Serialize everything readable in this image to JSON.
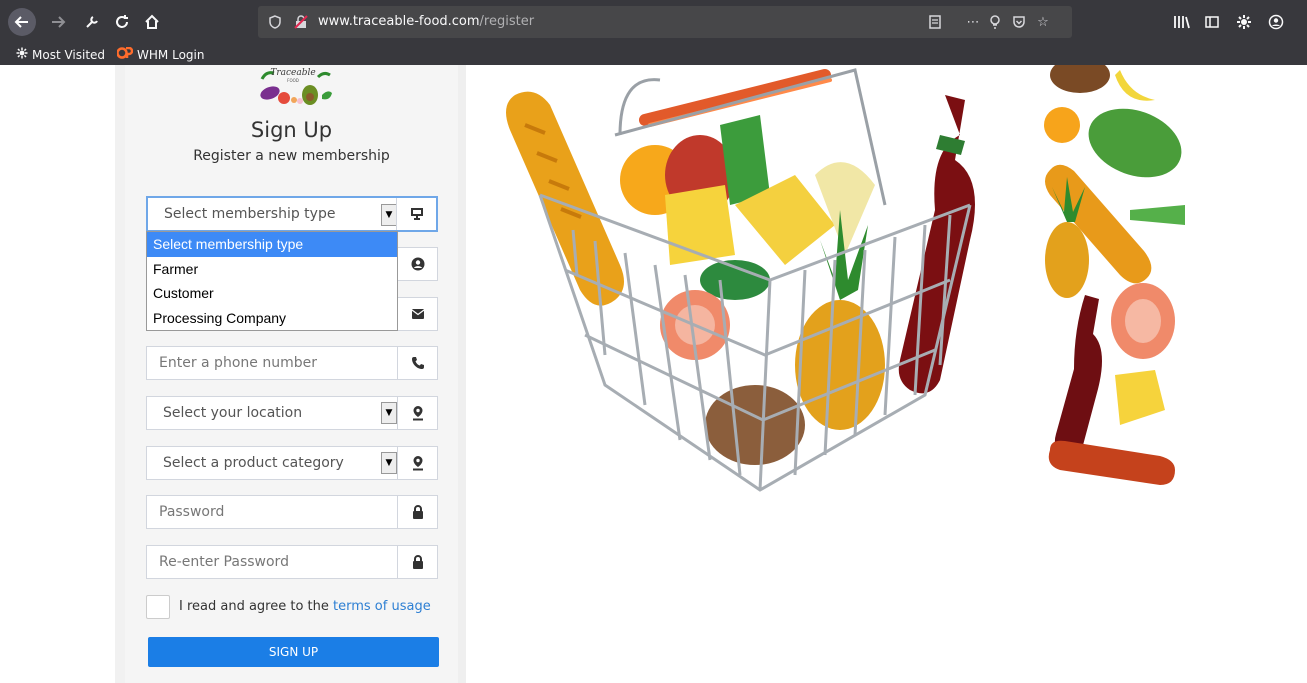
{
  "browser": {
    "url_host": "www.traceable-food.com",
    "url_path": "/register",
    "bookmarks": [
      {
        "label": "Most Visited"
      },
      {
        "label": "WHM Login"
      }
    ]
  },
  "logo": {
    "text": "Traceable",
    "subtext": "FOOD"
  },
  "form": {
    "title": "Sign Up",
    "subtitle": "Register a new membership",
    "membership_select": "Select membership type",
    "membership_options": [
      "Select membership type",
      "Farmer",
      "Customer",
      "Processing Company"
    ],
    "phone_placeholder": "Enter a phone number",
    "location_select": "Select your location",
    "category_select": "Select a product category",
    "password_placeholder": "Password",
    "reenter_placeholder": "Re-enter Password",
    "agree_text": "I read and agree to the ",
    "terms_link": "terms of usage",
    "signup_button": "SIGN UP"
  },
  "colors": {
    "primary": "#1b7ee6",
    "dropdown_highlight": "#3d8af6",
    "chrome": "#38383d"
  }
}
